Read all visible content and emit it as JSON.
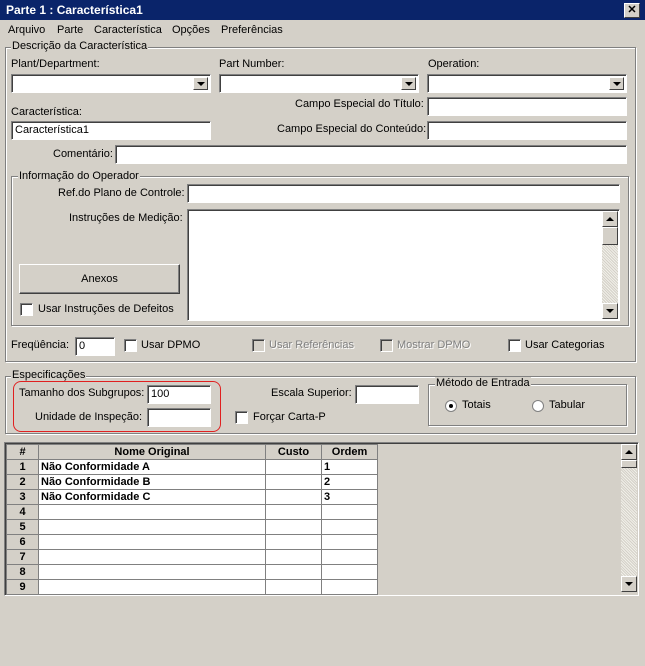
{
  "window": {
    "title": "Parte 1 : Característica1",
    "close_glyph": "✕"
  },
  "menu": [
    "Arquivo",
    "Parte",
    "Característica",
    "Opções",
    "Preferências"
  ],
  "descricao": {
    "group_title": "Descrição da Característica",
    "plant_label": "Plant/Department:",
    "part_label": "Part Number:",
    "operation_label": "Operation:",
    "caracteristica_label": "Característica:",
    "caracteristica_value": "Característica1",
    "campo_titulo_label": "Campo Especial do Título:",
    "campo_conteudo_label": "Campo Especial do Conteúdo:",
    "comentario_label": "Comentário:"
  },
  "operador": {
    "group_title": "Informação do Operador",
    "ref_label": "Ref.do Plano de Controle:",
    "instr_label": "Instruções de Medição:",
    "anexos_button": "Anexos",
    "usar_instr_label": "Usar Instruções de Defeitos"
  },
  "options_row": {
    "frequencia_label": "Freqüência:",
    "frequencia_value": "0",
    "usar_dpmo": "Usar DPMO",
    "usar_referencias": "Usar Referências",
    "mostrar_dpmo": "Mostrar DPMO",
    "usar_categorias": "Usar Categorias"
  },
  "especificacoes": {
    "group_title": "Especificações",
    "tamanho_label": "Tamanho dos Subgrupos:",
    "tamanho_value": "100",
    "unidade_label": "Unidade de Inspeção:",
    "escala_label": "Escala Superior:",
    "forcar_label": "Forçar Carta-P",
    "metodo_title": "Método de Entrada",
    "totais_label": "Totais",
    "tabular_label": "Tabular",
    "highlight_color": "#e02020"
  },
  "grid": {
    "headers": [
      "#",
      "Nome Original",
      "Custo",
      "Ordem"
    ],
    "rows": [
      {
        "n": "1",
        "nome": "Não Conformidade A",
        "custo": "",
        "ordem": "1"
      },
      {
        "n": "2",
        "nome": "Não Conformidade B",
        "custo": "",
        "ordem": "2"
      },
      {
        "n": "3",
        "nome": "Não Conformidade C",
        "custo": "",
        "ordem": "3"
      },
      {
        "n": "4",
        "nome": "",
        "custo": "",
        "ordem": ""
      },
      {
        "n": "5",
        "nome": "",
        "custo": "",
        "ordem": ""
      },
      {
        "n": "6",
        "nome": "",
        "custo": "",
        "ordem": ""
      },
      {
        "n": "7",
        "nome": "",
        "custo": "",
        "ordem": ""
      },
      {
        "n": "8",
        "nome": "",
        "custo": "",
        "ordem": ""
      },
      {
        "n": "9",
        "nome": "",
        "custo": "",
        "ordem": ""
      }
    ]
  }
}
